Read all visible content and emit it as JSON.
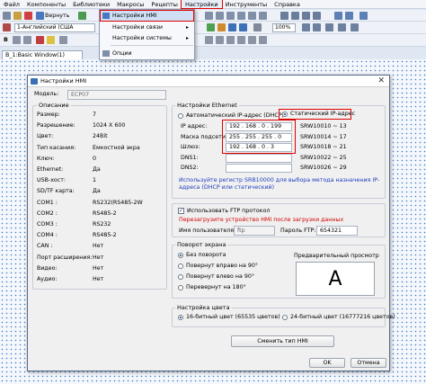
{
  "menubar": [
    "Файл",
    "Компоненты",
    "Библиотеки",
    "Макросы",
    "Рецепты",
    "Настройки",
    "Инструменты",
    "Справка"
  ],
  "toolbar": {
    "undo_label": "Вернуть",
    "language_combo": "1-Английский (США",
    "zoom": "100%",
    "b_label": "B"
  },
  "dropdown": {
    "items": [
      "Настройки HMI",
      "Настройки связи",
      "Настройки системы",
      "Опции"
    ]
  },
  "doc_tab": "B_1:Basic Window(1)",
  "dialog": {
    "title": "Настройки HMI",
    "model_label": "Модель:",
    "model_value": "ECP07",
    "desc_group": "Описание",
    "specs": [
      {
        "k": "Размер:",
        "v": "7"
      },
      {
        "k": "Разрешение:",
        "v": "1024 X 600"
      },
      {
        "k": "Цвет:",
        "v": "24Bit"
      },
      {
        "k": "Тип касания:",
        "v": "Емкостной экра"
      },
      {
        "k": "Ключ:",
        "v": "0"
      },
      {
        "k": "Ethernet:",
        "v": "Да"
      },
      {
        "k": "USB-хост:",
        "v": "1"
      },
      {
        "k": "SD/TF карта:",
        "v": "Да"
      },
      {
        "k": "COM1 :",
        "v": "RS232(RS485-2W"
      },
      {
        "k": "COM2 :",
        "v": "RS485-2"
      },
      {
        "k": "COM3 :",
        "v": "RS232"
      },
      {
        "k": "COM4 :",
        "v": "RS485-2"
      },
      {
        "k": "CAN :",
        "v": "Нет"
      },
      {
        "k": "Порт расширения:",
        "v": "Нет"
      },
      {
        "k": "Видео:",
        "v": "Нет"
      },
      {
        "k": "Аудио:",
        "v": "Нет"
      }
    ],
    "eth_group": "Настройки Ethernet",
    "dhcp_label": "Автоматический IP-адрес (DHCP)",
    "static_label": "Статический IP-адрес",
    "ip_rows": [
      {
        "k": "IP адрес:",
        "v": "192 . 168 . 0 . 199",
        "reg": "SRW10010 ~ 13"
      },
      {
        "k": "Маска подсети:",
        "v": "255 . 255 . 255 . 0",
        "reg": "SRW10014 ~ 17"
      },
      {
        "k": "Шлюз:",
        "v": "192 . 168 . 0 . 3",
        "reg": "SRW10018 ~ 21"
      },
      {
        "k": "DNS1:",
        "v": "",
        "reg": "SRW10022 ~ 25"
      },
      {
        "k": "DNS2:",
        "v": "",
        "reg": "SRW10026 ~ 29"
      }
    ],
    "eth_note": "Используйте регистр SRB10000 для выбора метода назначения IP-адреса (DHCP или статический)",
    "ftp_check": "Использовать FTP протокол",
    "ftp_warning": "Перезагрузите устройство HMI после загрузки данных",
    "ftp_user_label": "Имя пользователя:",
    "ftp_user_value": "ftp",
    "ftp_pass_label": "Пароль FTP:",
    "ftp_pass_value": "654321",
    "rot_group": "Поворот экрана",
    "rot_options": [
      "Без поворота",
      "Повернут вправо на 90°",
      "Повернут влево на 90°",
      "Перевернут на 180°"
    ],
    "preview_label": "Предварительный просмотр",
    "preview_letter": "A",
    "color_group": "Настройка цвета",
    "color_options": [
      "16-битный цвет (65535 цветов)",
      "24-битный цвет (16777216 цветов)"
    ],
    "change_button": "Сменить тип HMI",
    "ok_button": "OK",
    "cancel_button": "Отмена"
  }
}
